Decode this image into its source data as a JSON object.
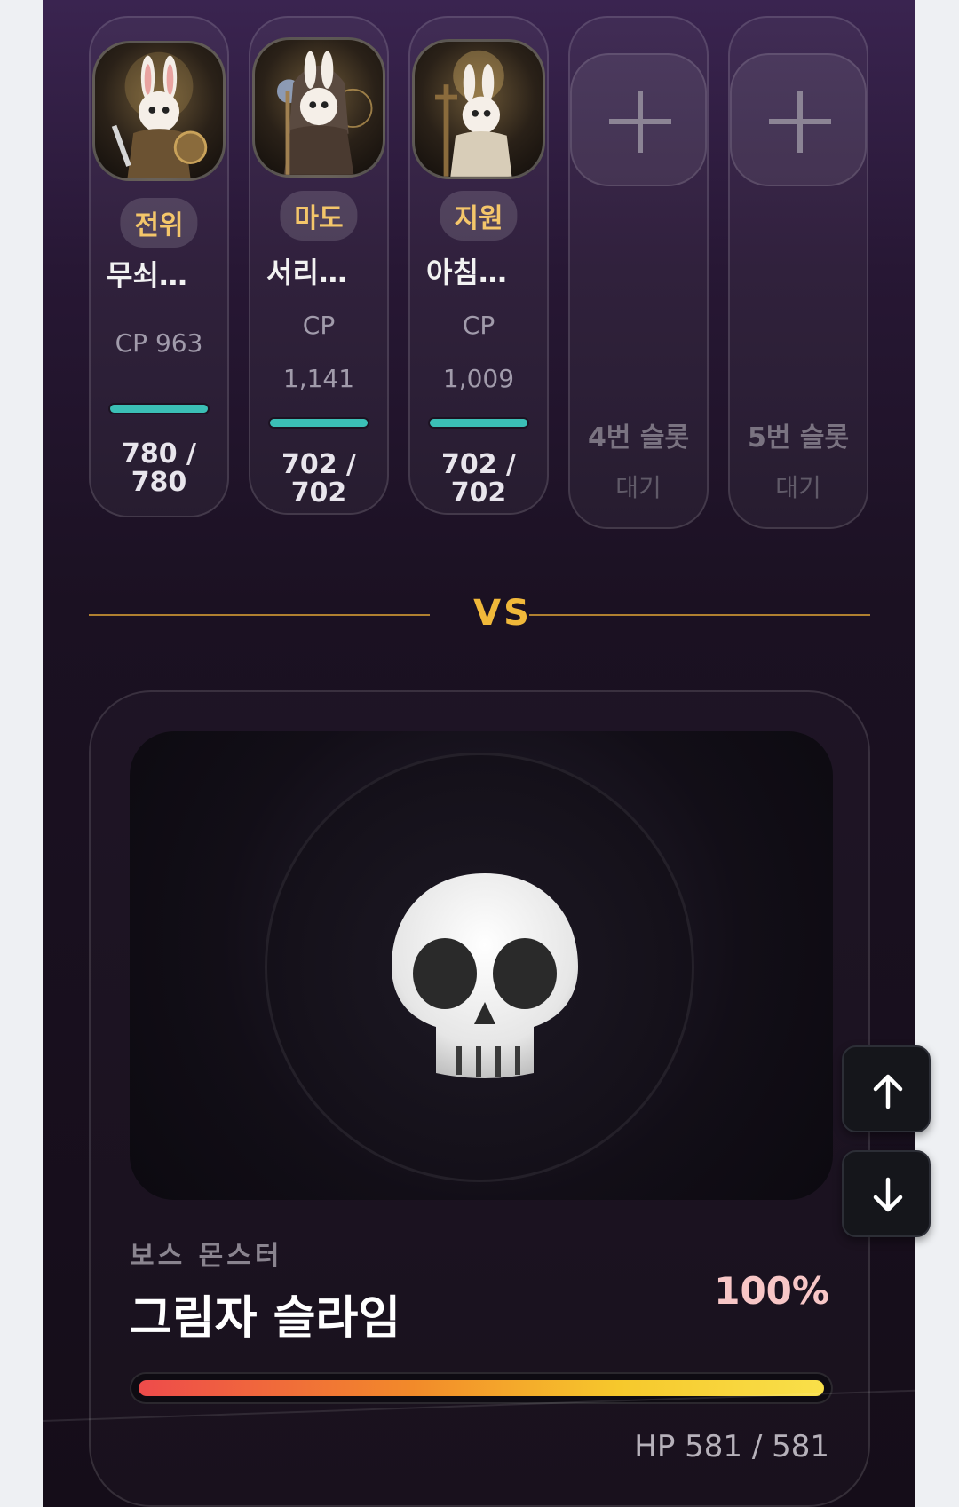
{
  "party": [
    {
      "role": "전위",
      "name": "무쇠…",
      "cp_label": "CP 963",
      "cp_value": "",
      "hp_value": "780 /",
      "hp_max": "780",
      "hp_fraction": 1.0,
      "portrait": "rabbit-knight"
    },
    {
      "role": "마도",
      "name": "서리…",
      "cp_label": "CP",
      "cp_value": "1,141",
      "hp_value": "702 /",
      "hp_max": "702",
      "hp_fraction": 1.0,
      "portrait": "rabbit-mage"
    },
    {
      "role": "지원",
      "name": "아침…",
      "cp_label": "CP",
      "cp_value": "1,009",
      "hp_value": "702 /",
      "hp_max": "702",
      "hp_fraction": 1.0,
      "portrait": "rabbit-cleric"
    }
  ],
  "empty_slots": [
    {
      "label": "4번 슬롯",
      "status": "대기"
    },
    {
      "label": "5번 슬롯",
      "status": "대기"
    }
  ],
  "vs_label": "VS",
  "boss": {
    "subtitle": "보스 몬스터",
    "name": "그림자 슬라임",
    "hp_percent_label": "100%",
    "hp_fraction": 1.0,
    "hp_text": "HP 581 / 581",
    "icon": "skull-icon"
  },
  "colors": {
    "accent_gold": "#f0b83a",
    "hp_teal": "#3bbfb6",
    "boss_bar_start": "#ee4b4b",
    "boss_bar_end": "#f9e04a"
  },
  "controls": {
    "scroll_up_icon": "arrow-up-icon",
    "scroll_down_icon": "arrow-down-icon"
  }
}
